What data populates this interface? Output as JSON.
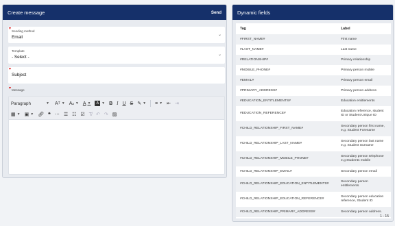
{
  "left_panel": {
    "title": "Create message",
    "send_label": "Send",
    "sending_method": {
      "label": "Sending method",
      "value": "Email"
    },
    "template": {
      "label": "Template",
      "value": "- Select -"
    },
    "subject": {
      "placeholder": "Subject"
    },
    "message": {
      "label": "Message",
      "toolbar": {
        "paragraph": "Paragraph"
      }
    }
  },
  "right_panel": {
    "title": "Dynamic fields",
    "columns": [
      "Tag",
      "Label"
    ],
    "rows": [
      [
        "#FIRST_NAME#",
        "First name"
      ],
      [
        "#LAST_NAME#",
        "Last name"
      ],
      [
        "#RELATIONSHIP#",
        "Primary relationship"
      ],
      [
        "#MOBILE_PHONE#",
        "Primary person mobile"
      ],
      [
        "#EMAIL#",
        "Primary person email"
      ],
      [
        "#PRIMARY_ADDRESS#",
        "Primary person address"
      ],
      [
        "#EDUCATION_ENTITLEMENTS#",
        "Education entitlements"
      ],
      [
        "#EDUCATION_REFERENCE#",
        "Education reference, student ID or Student Unique ID"
      ],
      [
        "#CHILD_RELATIONSHIP_FIRST_NAME#",
        "Secondary person first name, e.g. Student Forename"
      ],
      [
        "#CHILD_RELATIONSHIP_LAST_NAME#",
        "Secondary person last name e.g. Student Surname"
      ],
      [
        "#CHILD_RELATIONSHIP_MOBILE_PHONE#",
        "Secondary person telephone e.g Students mobile"
      ],
      [
        "#CHILD_RELATIONSHIP_EMAIL#",
        "Secondary person email"
      ],
      [
        "#CHILD_RELATIONSHIP_EDUCATION_ENTITLEMENTS#",
        "Secondary person entitlements"
      ],
      [
        "#CHILD_RELATIONSHIP_EDUCATION_REFERENCE#",
        "Secondary person education reference, Student ID"
      ],
      [
        "#CHILD_RELATIONSHIP_PRIMARY_ADDRESS#",
        "Secondary person address."
      ]
    ],
    "pager": "1 - 15"
  },
  "colors": {
    "header": "#15306a",
    "required": "#dd1111"
  }
}
